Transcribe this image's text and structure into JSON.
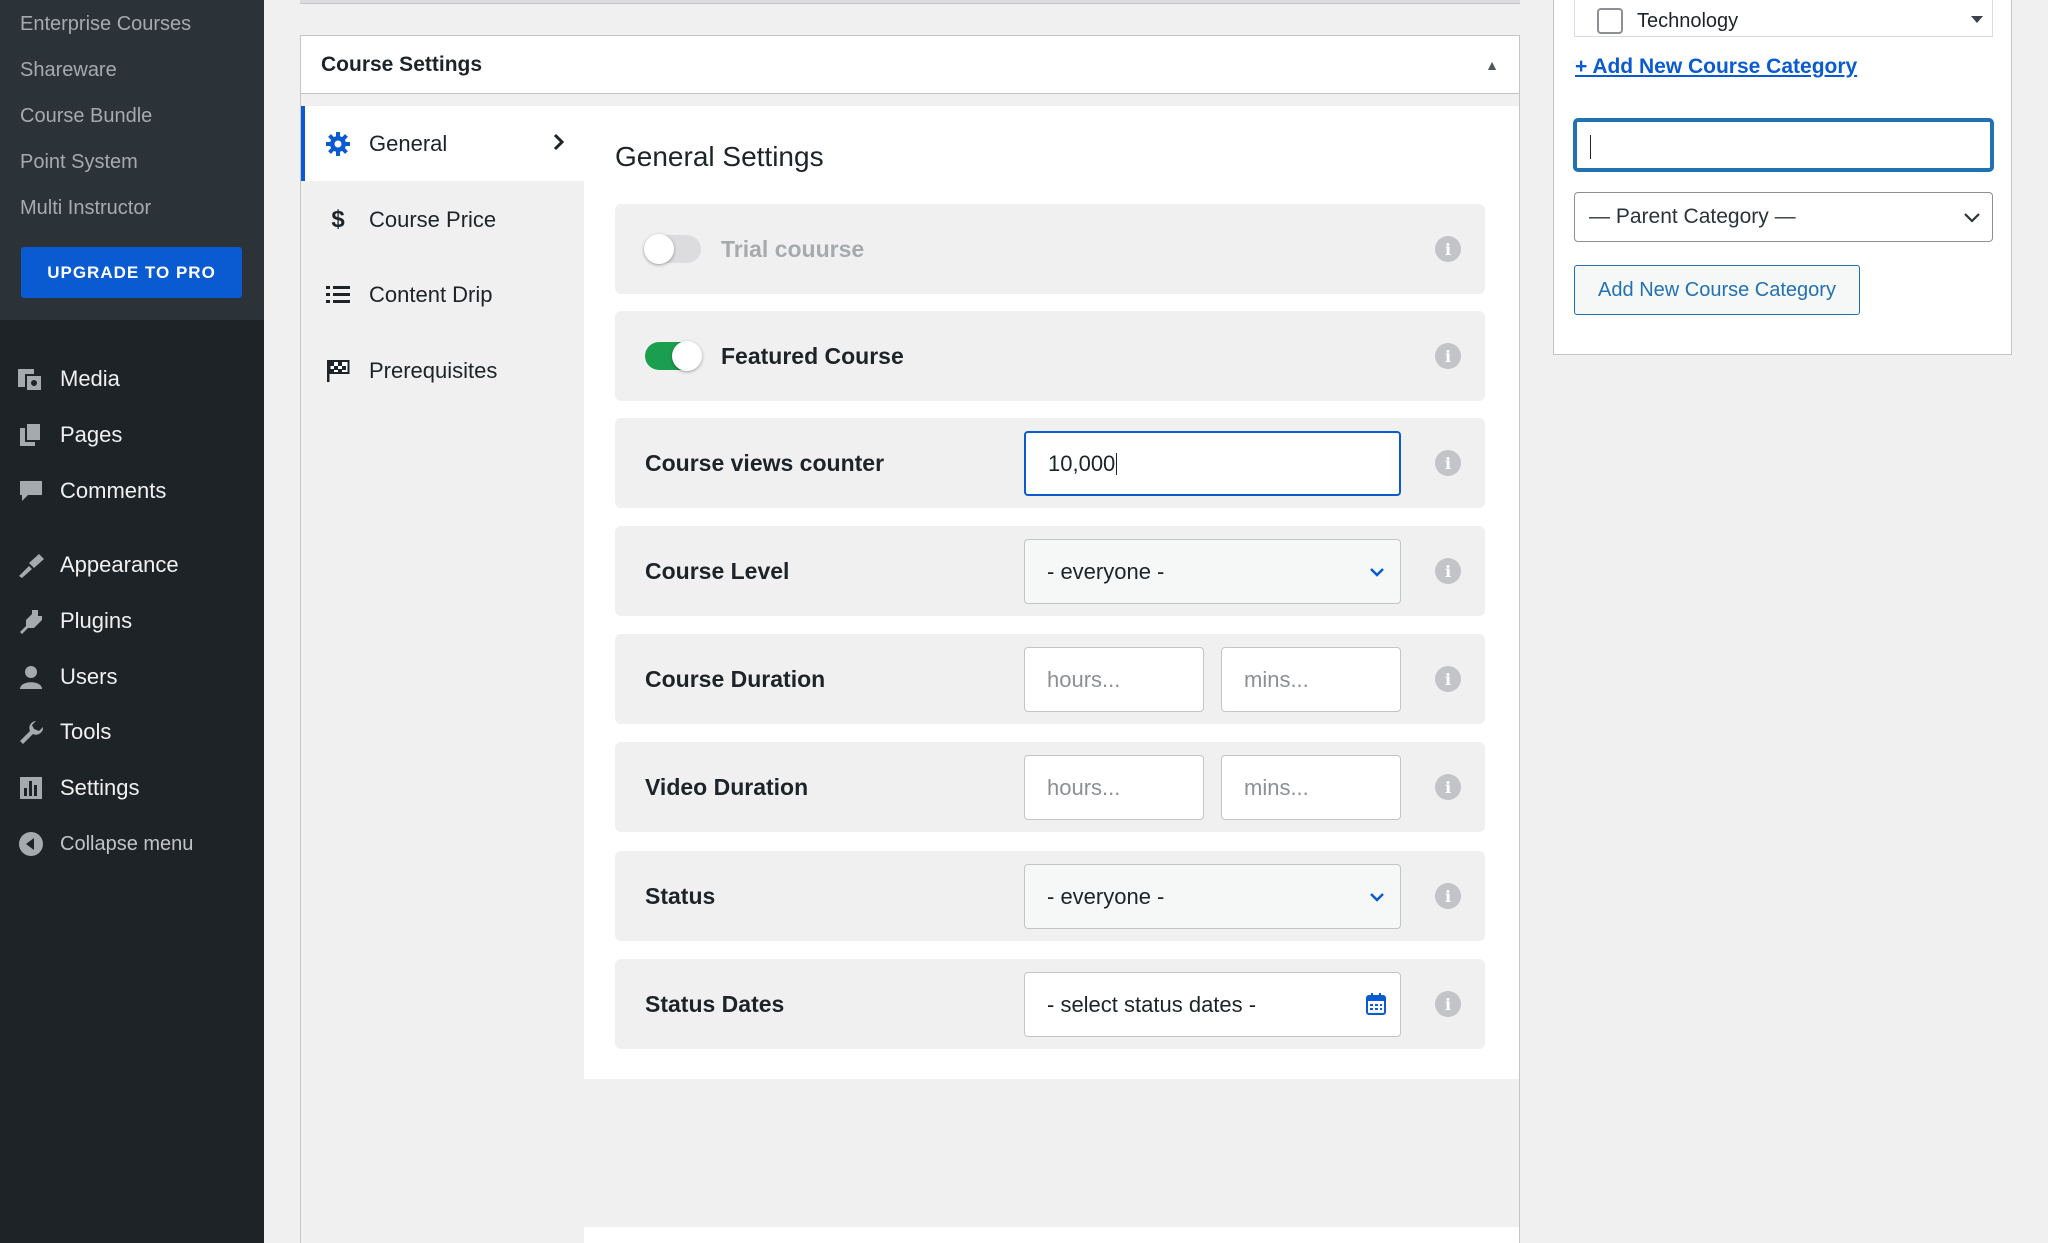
{
  "sidebar": {
    "submenu": [
      "Enterprise Courses",
      "Shareware",
      "Course Bundle",
      "Point System",
      "Multi Instructor"
    ],
    "upgrade_label": "UPGRADE TO PRO",
    "nav": [
      {
        "label": "Media",
        "icon": "media-icon"
      },
      {
        "label": "Pages",
        "icon": "pages-icon"
      },
      {
        "label": "Comments",
        "icon": "comments-icon"
      },
      {
        "label": "Appearance",
        "icon": "appearance-icon"
      },
      {
        "label": "Plugins",
        "icon": "plugins-icon"
      },
      {
        "label": "Users",
        "icon": "users-icon"
      },
      {
        "label": "Tools",
        "icon": "tools-icon"
      },
      {
        "label": "Settings",
        "icon": "settings-icon"
      }
    ],
    "collapse_label": "Collapse menu"
  },
  "course_settings": {
    "title": "Course Settings",
    "tabs": [
      {
        "label": "General",
        "icon": "gear-icon",
        "active": true
      },
      {
        "label": "Course Price",
        "icon": "dollar-icon"
      },
      {
        "label": "Content Drip",
        "icon": "list-icon"
      },
      {
        "label": "Prerequisites",
        "icon": "flag-icon"
      }
    ],
    "panel_title": "General Settings",
    "rows": {
      "trial": {
        "label": "Trial couurse",
        "enabled": false
      },
      "featured": {
        "label": "Featured Course",
        "enabled": true
      },
      "views": {
        "label": "Course views counter",
        "value": "10,000"
      },
      "level": {
        "label": "Course Level",
        "value": "- everyone -"
      },
      "course_duration": {
        "label": "Course Duration",
        "hours_placeholder": "hours...",
        "mins_placeholder": "mins..."
      },
      "video_duration": {
        "label": "Video Duration",
        "hours_placeholder": "hours...",
        "mins_placeholder": "mins..."
      },
      "status": {
        "label": "Status",
        "value": "- everyone -"
      },
      "status_dates": {
        "label": "Status Dates",
        "placeholder": "- select status dates -"
      }
    }
  },
  "categories": {
    "item": "Technology",
    "add_link": "+ Add New Course Category",
    "parent_select": "— Parent Category —",
    "add_button": "Add New Course Category"
  },
  "colors": {
    "accent": "#0a5bd1",
    "sidebar_bg": "#1d2327",
    "toggle_on": "#1a9f4e"
  }
}
